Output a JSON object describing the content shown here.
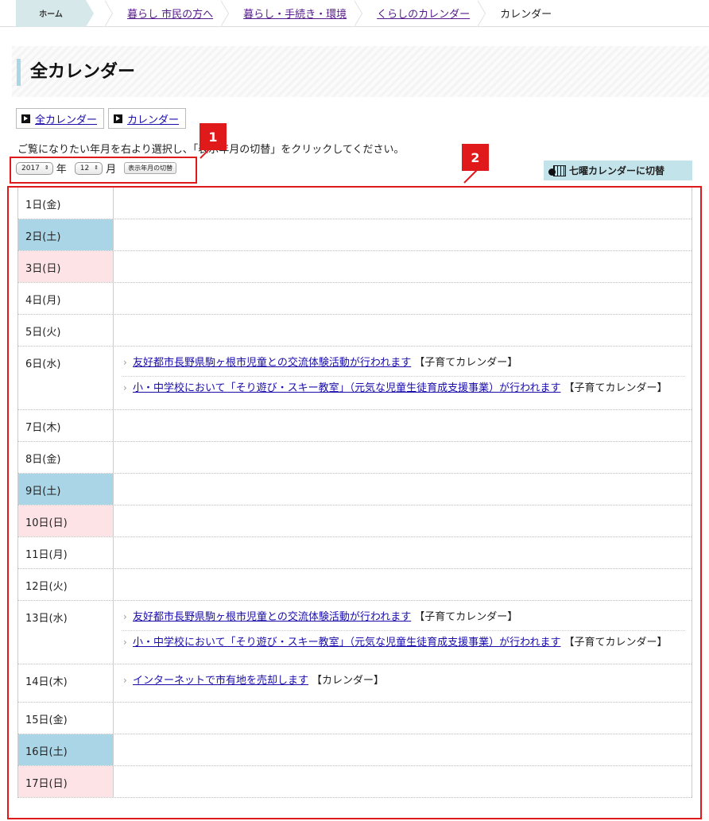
{
  "breadcrumb": {
    "home": "ホーム",
    "items": [
      "暮らし 市民の方へ",
      "暮らし・手続き・環境",
      "くらしのカレンダー"
    ],
    "current": "カレンダー"
  },
  "page": {
    "title": "全カレンダー",
    "tabs": [
      "全カレンダー",
      "カレンダー"
    ],
    "instruction": "ご覧になりたい年月を右より選択し、「表示年月の切替」をクリックしてください。"
  },
  "selector": {
    "year": "2017",
    "year_unit": "年",
    "month": "12",
    "month_unit": "月",
    "switch_label": "表示年月の切替"
  },
  "week_calendar_button": "七曜カレンダーに切替",
  "annotations": {
    "badge1": "1",
    "badge2": "2"
  },
  "days": [
    {
      "date": "1日(金)",
      "type": "weekday",
      "events": []
    },
    {
      "date": "2日(土)",
      "type": "sat",
      "events": []
    },
    {
      "date": "3日(日)",
      "type": "sun",
      "events": []
    },
    {
      "date": "4日(月)",
      "type": "weekday",
      "events": []
    },
    {
      "date": "5日(火)",
      "type": "weekday",
      "events": []
    },
    {
      "date": "6日(水)",
      "type": "weekday",
      "events": [
        {
          "title": "友好都市長野県駒ヶ根市児童との交流体験活動が行われます",
          "category": "【子育てカレンダー】"
        },
        {
          "title": "小・中学校において「そり遊び・スキー教室」（元気な児童生徒育成支援事業）が行われます",
          "category": "【子育てカレンダー】"
        }
      ]
    },
    {
      "date": "7日(木)",
      "type": "weekday",
      "events": []
    },
    {
      "date": "8日(金)",
      "type": "weekday",
      "events": []
    },
    {
      "date": "9日(土)",
      "type": "sat",
      "events": []
    },
    {
      "date": "10日(日)",
      "type": "sun",
      "events": []
    },
    {
      "date": "11日(月)",
      "type": "weekday",
      "events": []
    },
    {
      "date": "12日(火)",
      "type": "weekday",
      "events": []
    },
    {
      "date": "13日(水)",
      "type": "weekday",
      "events": [
        {
          "title": "友好都市長野県駒ヶ根市児童との交流体験活動が行われます",
          "category": "【子育てカレンダー】"
        },
        {
          "title": "小・中学校において「そり遊び・スキー教室」（元気な児童生徒育成支援事業）が行われます",
          "category": "【子育てカレンダー】"
        }
      ]
    },
    {
      "date": "14日(木)",
      "type": "weekday",
      "events": [
        {
          "title": "インターネットで市有地を売却します",
          "category": "【カレンダー】"
        }
      ]
    },
    {
      "date": "15日(金)",
      "type": "weekday",
      "events": []
    },
    {
      "date": "16日(土)",
      "type": "sat",
      "events": []
    },
    {
      "date": "17日(日)",
      "type": "sun",
      "events": []
    }
  ]
}
